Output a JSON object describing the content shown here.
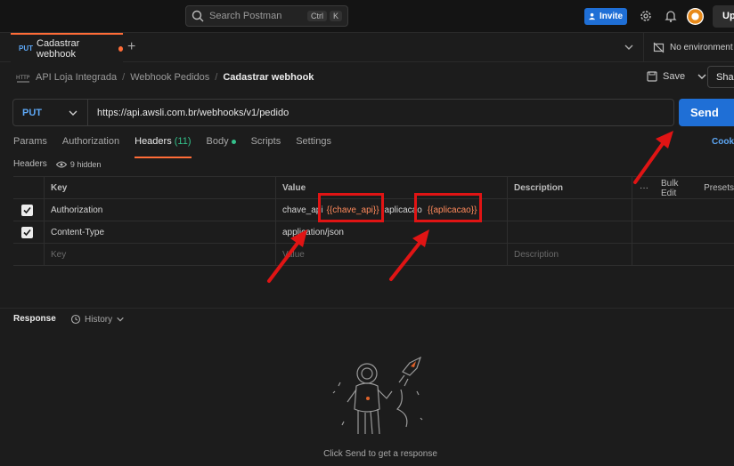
{
  "topbar": {
    "search_placeholder": "Search Postman",
    "kbd1": "Ctrl",
    "kbd2": "K",
    "invite": "Invite",
    "upgrade": "Up"
  },
  "tabbar": {
    "tab_method": "PUT",
    "tab_name": "Cadastrar webhook",
    "plus": "+",
    "environment": "No environment"
  },
  "breadcrumb": {
    "c1": "API Loja Integrada",
    "sep": "/",
    "c2": "Webhook Pedidos",
    "current": "Cadastrar webhook",
    "save": "Save",
    "share": "Shar"
  },
  "request": {
    "method": "PUT",
    "url": "https://api.awsli.com.br/webhooks/v1/pedido",
    "send": "Send"
  },
  "tabs": {
    "params": "Params",
    "authorization": "Authorization",
    "headers": "Headers",
    "headers_count": "(11)",
    "body": "Body",
    "scripts": "Scripts",
    "settings": "Settings",
    "cookies": "Cooki"
  },
  "headers_section": {
    "label": "Headers",
    "hidden": "9 hidden"
  },
  "table": {
    "col_key": "Key",
    "col_value": "Value",
    "col_description": "Description",
    "more": "···",
    "bulk_edit": "Bulk Edit",
    "presets": "Presets",
    "rows": [
      {
        "key": "Authorization",
        "value_a": "chave_api",
        "value_var1": "{{chave_api}}",
        "value_b": "aplicacao",
        "value_var2": "{{aplicacao}}"
      },
      {
        "key": "Content-Type",
        "value": "application/json"
      }
    ],
    "placeholder_key": "Key",
    "placeholder_value": "Value",
    "placeholder_description": "Description"
  },
  "response": {
    "title": "Response",
    "history": "History",
    "hint": "Click Send to get a response"
  },
  "colors": {
    "accent": "#ff6c37",
    "primary": "#1f6fd6",
    "annotation": "#e01414"
  }
}
